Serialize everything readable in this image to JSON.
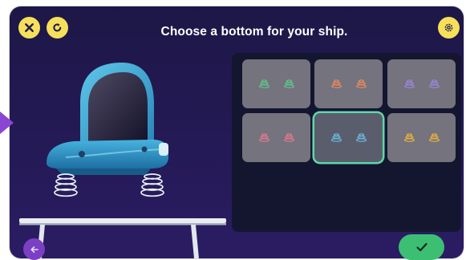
{
  "header": {
    "title": "Choose a bottom for your ship."
  },
  "controls": {
    "close": "close-icon",
    "restart": "restart-icon",
    "settings": "gear-icon",
    "back": "arrow-left-icon",
    "confirm": "check-icon"
  },
  "options": {
    "selected_index": 4,
    "tiles": [
      {
        "icon": "spring-icon",
        "color": "#5ec48b"
      },
      {
        "icon": "spring-icon",
        "color": "#e58a5c"
      },
      {
        "icon": "spring-icon",
        "color": "#9b86d8"
      },
      {
        "icon": "spring-icon",
        "color": "#df7a8c"
      },
      {
        "icon": "spring-icon",
        "color": "#6cb7e0"
      },
      {
        "icon": "spring-icon",
        "color": "#e7b13c"
      }
    ]
  },
  "colors": {
    "accent_yellow": "#f6e05a",
    "confirm_green": "#3dbf73",
    "selection_outline": "#5fd7a9",
    "ship_body": "#3ea7d6",
    "background": "#1d1747"
  }
}
